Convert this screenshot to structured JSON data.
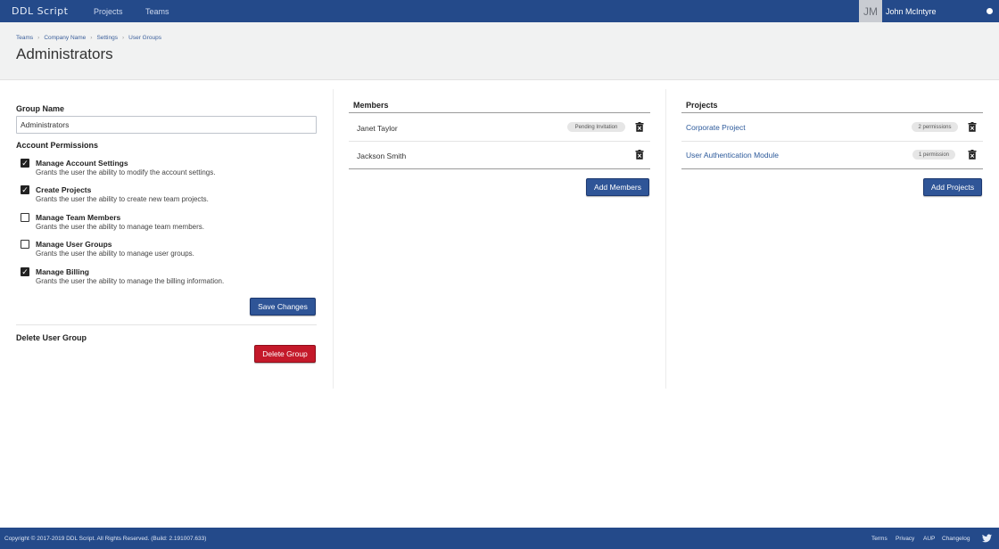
{
  "nav": {
    "logo": "DDL Script",
    "projects": "Projects",
    "teams": "Teams",
    "avatar_initials": "JM",
    "user_name": "John McIntyre"
  },
  "breadcrumb": [
    "Teams",
    "Company Name",
    "Settings",
    "User Groups"
  ],
  "page_title": "Administrators",
  "group": {
    "name_label": "Group Name",
    "name_value": "Administrators",
    "permissions_label": "Account Permissions",
    "permissions": [
      {
        "title": "Manage Account Settings",
        "desc": "Grants the user the ability to modify the account settings.",
        "checked": true
      },
      {
        "title": "Create Projects",
        "desc": "Grants the user the ability to create new team projects.",
        "checked": true
      },
      {
        "title": "Manage Team Members",
        "desc": "Grants the user the ability to manage team members.",
        "checked": false
      },
      {
        "title": "Manage User Groups",
        "desc": "Grants the user the ability to manage user groups.",
        "checked": false
      },
      {
        "title": "Manage Billing",
        "desc": "Grants the user the ability to manage the billing information.",
        "checked": true
      }
    ],
    "save_label": "Save Changes",
    "delete_section_label": "Delete User Group",
    "delete_label": "Delete Group"
  },
  "members": {
    "title": "Members",
    "items": [
      {
        "name": "Janet Taylor",
        "badge": "Pending Invitation"
      },
      {
        "name": "Jackson Smith",
        "badge": ""
      }
    ],
    "add_label": "Add Members"
  },
  "projects": {
    "title": "Projects",
    "items": [
      {
        "name": "Corporate Project",
        "badge": "2 permissions"
      },
      {
        "name": "User Authentication Module",
        "badge": "1 permission"
      }
    ],
    "add_label": "Add Projects"
  },
  "footer": {
    "copyright": "Copyright © 2017-2019 DDL Script. All Rights Reserved. (Build: 2.191007.633)",
    "links": [
      "Terms",
      "Privacy",
      "AUP",
      "Changelog"
    ]
  },
  "colors": {
    "nav_bg": "#244a8a",
    "primary_button": "#2f5597",
    "danger_button": "#c4192a",
    "link": "#2d5a9b"
  }
}
